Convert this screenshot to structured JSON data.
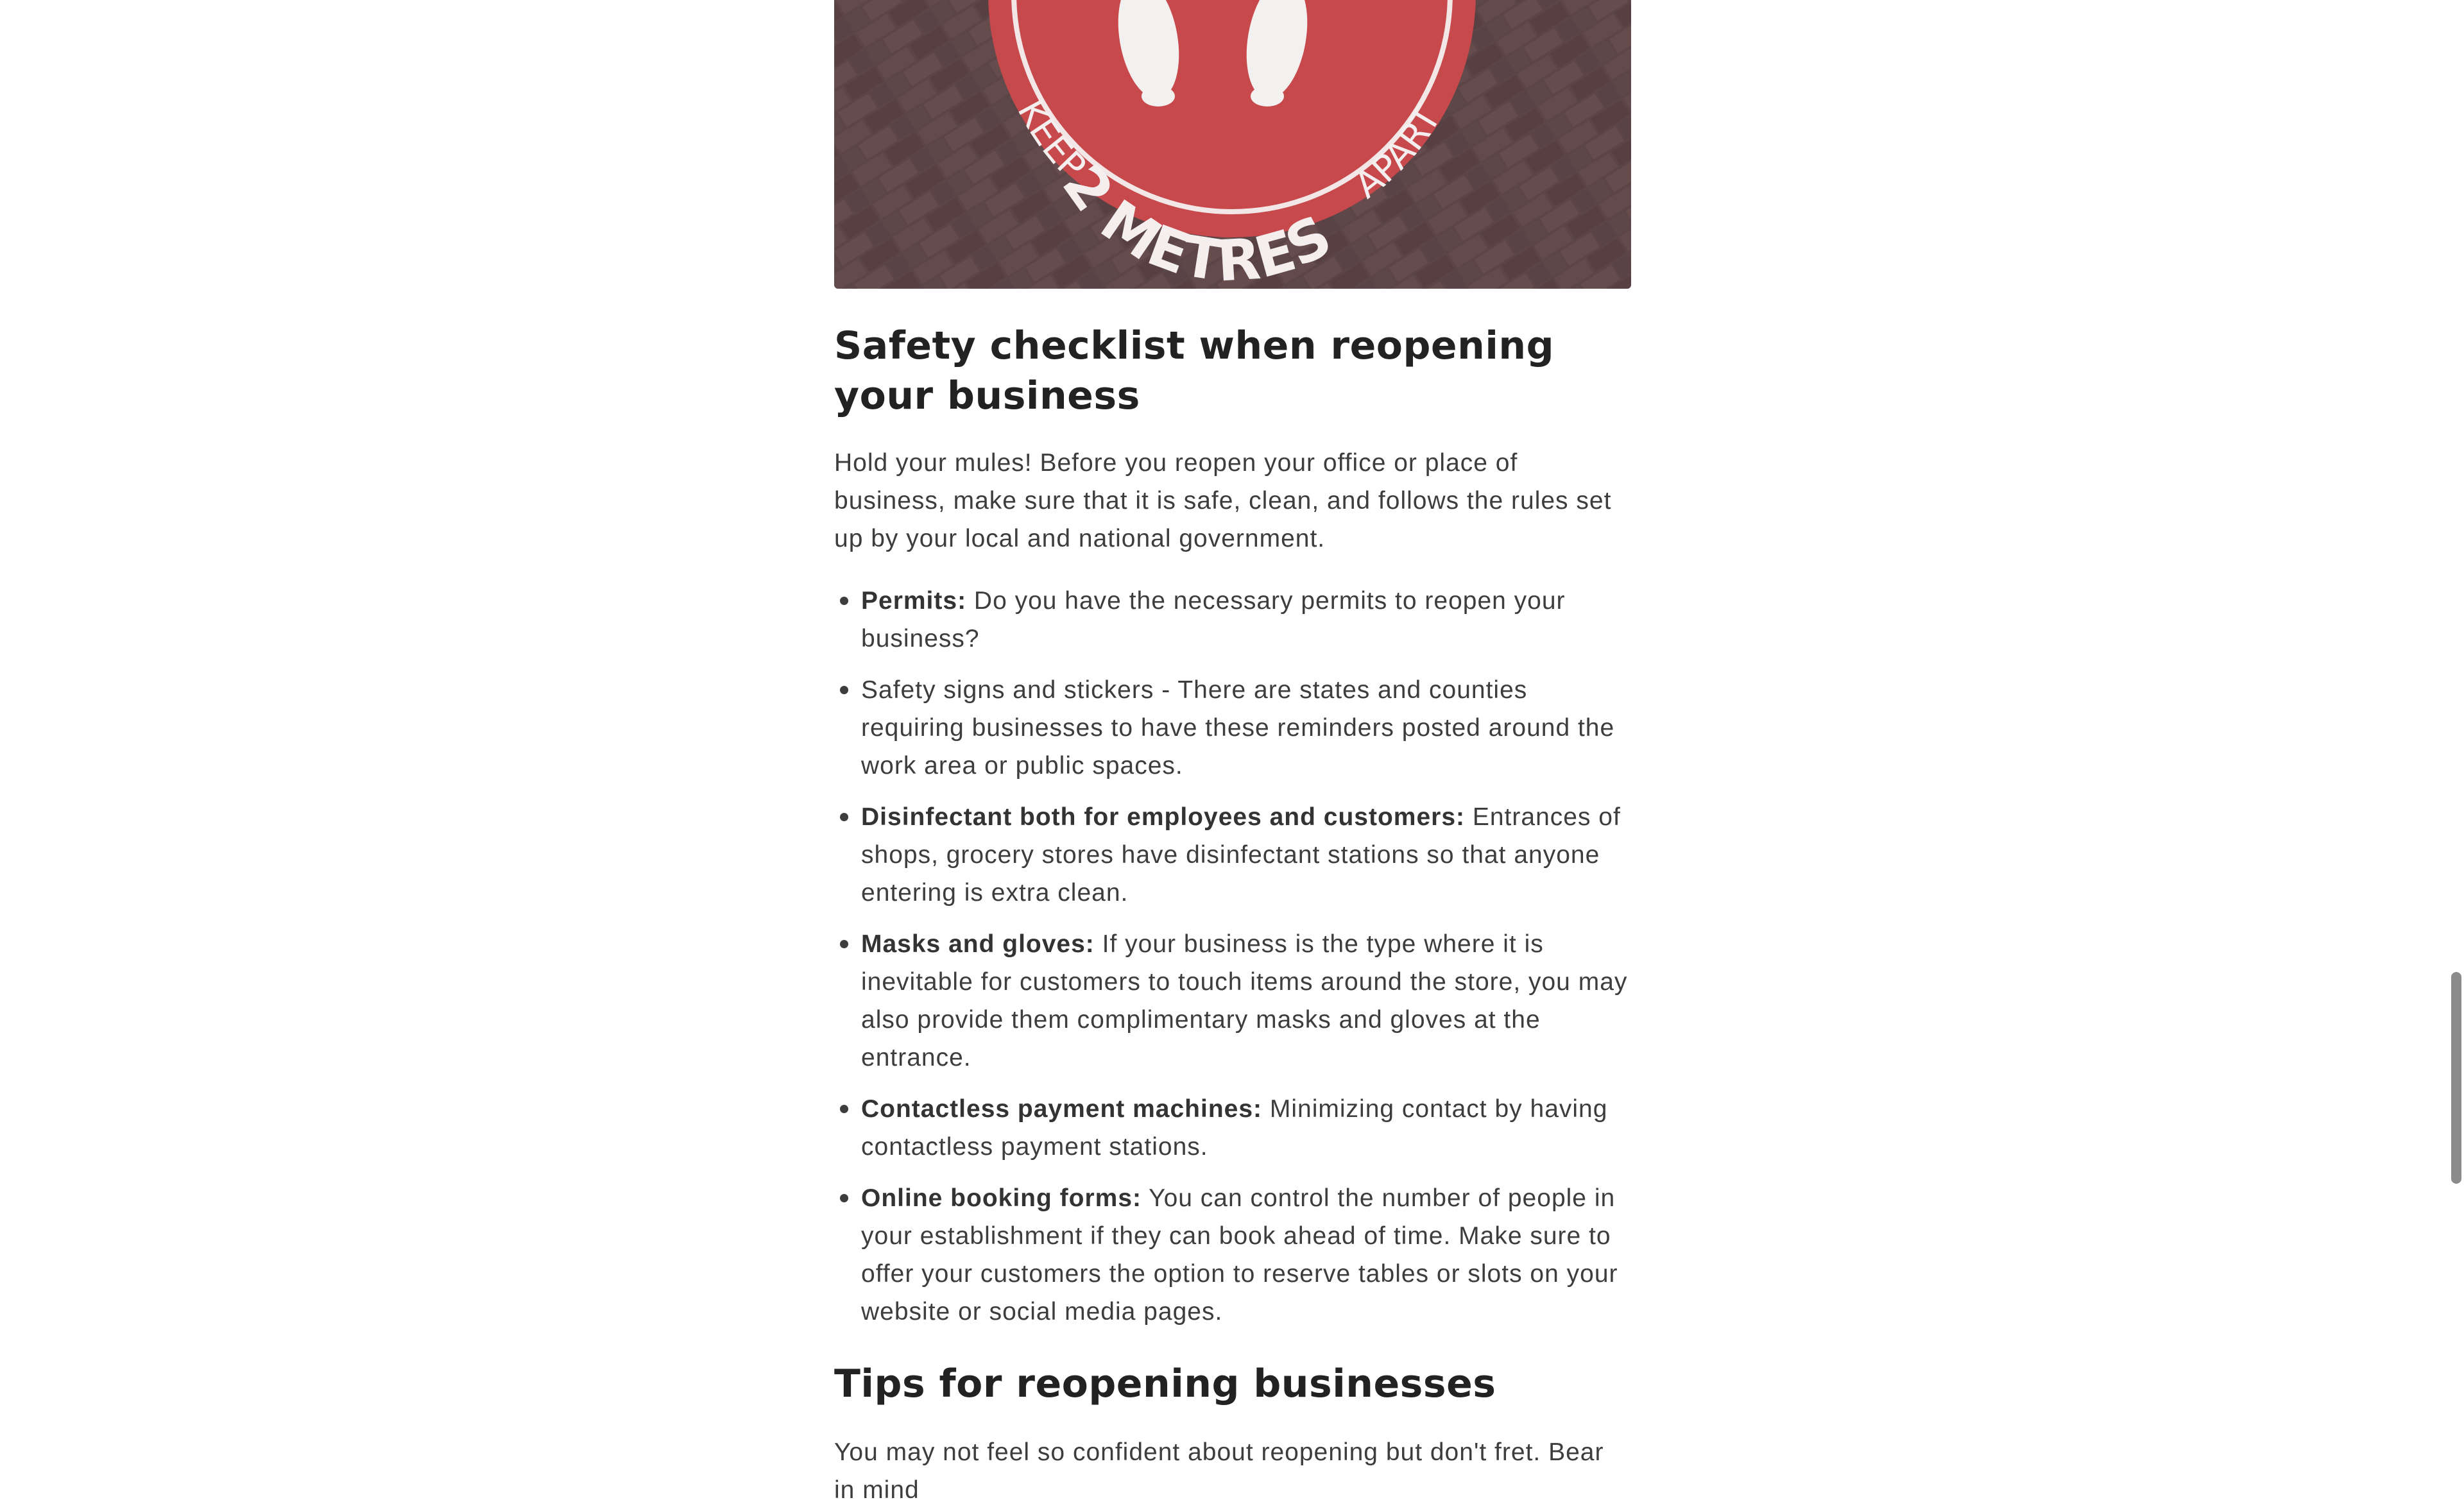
{
  "hero_image": {
    "sign_text_left": "KEEP",
    "sign_text_center": "2 METRES",
    "sign_text_right": "APART",
    "colors": {
      "sign": "#c8494c",
      "pavement": "#5a4446"
    }
  },
  "section1": {
    "heading": "Safety checklist when reopening your business",
    "intro": "Hold your mules! Before you reopen your office or place of business, make sure that it is safe, clean, and follows the rules set up by your local and national government.",
    "items": [
      {
        "label": "Permits:",
        "text": " Do you have the necessary permits to reopen your business?"
      },
      {
        "label": "",
        "text": "Safety signs and stickers - There are states and counties requiring businesses to have these reminders posted around the work area or public spaces."
      },
      {
        "label": "Disinfectant both for employees and customers:",
        "text": " Entrances of shops, grocery stores have disinfectant stations so that anyone entering is extra clean."
      },
      {
        "label": "Masks and gloves:",
        "text": " If your business is the type where it is inevitable for customers to touch items around the store, you may also provide them complimentary masks and gloves at the entrance."
      },
      {
        "label": "Contactless payment machines:",
        "text": " Minimizing contact by having contactless payment stations."
      },
      {
        "label": "Online booking forms:",
        "text": " You can control the number of people in your establishment if they can book ahead of time. Make sure to offer your customers the option to reserve tables or slots on your website or social media pages."
      }
    ]
  },
  "section2": {
    "heading": "Tips for reopening businesses",
    "intro": "You may not feel so confident about reopening but don't fret. Bear in mind"
  }
}
